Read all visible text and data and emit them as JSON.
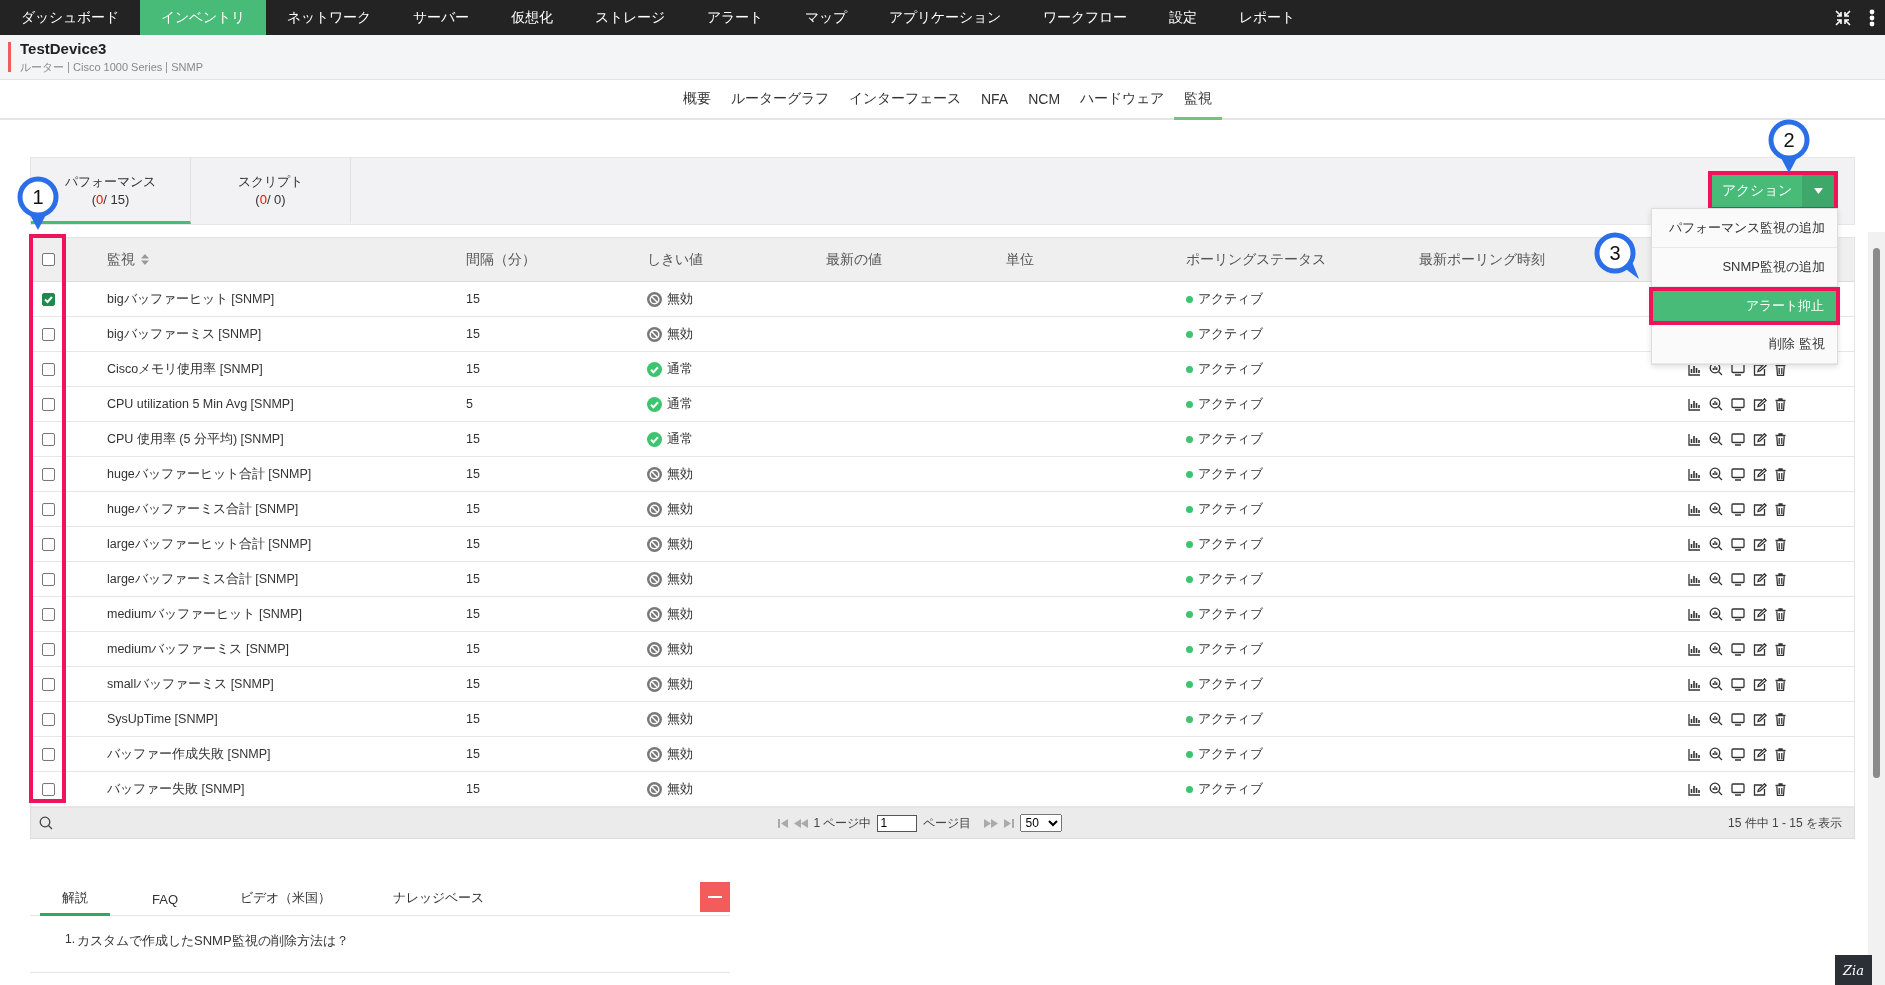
{
  "nav": {
    "items": [
      {
        "label": "ダッシュボード",
        "selected": false
      },
      {
        "label": "インベントリ",
        "selected": true
      },
      {
        "label": "ネットワーク",
        "selected": false
      },
      {
        "label": "サーバー",
        "selected": false
      },
      {
        "label": "仮想化",
        "selected": false
      },
      {
        "label": "ストレージ",
        "selected": false
      },
      {
        "label": "アラート",
        "selected": false
      },
      {
        "label": "マップ",
        "selected": false
      },
      {
        "label": "アプリケーション",
        "selected": false
      },
      {
        "label": "ワークフロー",
        "selected": false
      },
      {
        "label": "設定",
        "selected": false
      },
      {
        "label": "レポート",
        "selected": false
      }
    ]
  },
  "device": {
    "name": "TestDevice3",
    "details": [
      "ルーター",
      "Cisco 1000 Series",
      "SNMP"
    ]
  },
  "subtabs": [
    {
      "label": "概要",
      "selected": false
    },
    {
      "label": "ルーターグラフ",
      "selected": false
    },
    {
      "label": "インターフェース",
      "selected": false
    },
    {
      "label": "NFA",
      "selected": false
    },
    {
      "label": "NCM",
      "selected": false
    },
    {
      "label": "ハードウェア",
      "selected": false
    },
    {
      "label": "監視",
      "selected": true
    }
  ],
  "monitor_tabs": [
    {
      "label": "パフォーマンス",
      "count": {
        "open": "(",
        "value": "0",
        "rest": "/ 15)"
      },
      "selected": true
    },
    {
      "label": "スクリプト",
      "count": {
        "open": "(",
        "value": "0",
        "rest": "/ 0)"
      },
      "selected": false
    }
  ],
  "action_button": {
    "label": "アクション",
    "highlighted": true
  },
  "action_menu": {
    "items": [
      {
        "label": "パフォーマンス監視の追加",
        "selected": false,
        "highlighted": false
      },
      {
        "label": "SNMP監視の追加",
        "selected": false,
        "highlighted": false
      },
      {
        "label": "アラート抑止",
        "selected": true,
        "highlighted": true
      },
      {
        "label": "削除 監視",
        "selected": false,
        "highlighted": false
      }
    ]
  },
  "table": {
    "select_all": {
      "checked": false
    },
    "checkbox_column_highlighted": true,
    "columns": [
      {
        "label": "監視",
        "sortable": true
      },
      {
        "label": "間隔（分）",
        "sortable": false
      },
      {
        "label": "しきい値",
        "sortable": false
      },
      {
        "label": "最新の値",
        "sortable": false
      },
      {
        "label": "単位",
        "sortable": false
      },
      {
        "label": "ポーリングステータス",
        "sortable": false
      },
      {
        "label": "最新ポーリング時刻",
        "sortable": false
      }
    ],
    "rows": [
      {
        "checked": true,
        "name": "bigバッファーヒット [SNMP]",
        "interval": "15",
        "threshold": {
          "kind": "disabled",
          "label": "無効"
        },
        "status": "アクティブ"
      },
      {
        "checked": false,
        "name": "bigバッファーミス [SNMP]",
        "interval": "15",
        "threshold": {
          "kind": "disabled",
          "label": "無効"
        },
        "status": "アクティブ"
      },
      {
        "checked": false,
        "name": "Ciscoメモリ使用率 [SNMP]",
        "interval": "15",
        "threshold": {
          "kind": "normal",
          "label": "通常"
        },
        "status": "アクティブ"
      },
      {
        "checked": false,
        "name": "CPU utilization 5 Min Avg [SNMP]",
        "interval": "5",
        "threshold": {
          "kind": "normal",
          "label": "通常"
        },
        "status": "アクティブ"
      },
      {
        "checked": false,
        "name": "CPU 使用率 (5 分平均) [SNMP]",
        "interval": "15",
        "threshold": {
          "kind": "normal",
          "label": "通常"
        },
        "status": "アクティブ"
      },
      {
        "checked": false,
        "name": "hugeバッファーヒット合計 [SNMP]",
        "interval": "15",
        "threshold": {
          "kind": "disabled",
          "label": "無効"
        },
        "status": "アクティブ"
      },
      {
        "checked": false,
        "name": "hugeバッファーミス合計 [SNMP]",
        "interval": "15",
        "threshold": {
          "kind": "disabled",
          "label": "無効"
        },
        "status": "アクティブ"
      },
      {
        "checked": false,
        "name": "largeバッファーヒット合計 [SNMP]",
        "interval": "15",
        "threshold": {
          "kind": "disabled",
          "label": "無効"
        },
        "status": "アクティブ"
      },
      {
        "checked": false,
        "name": "largeバッファーミス合計 [SNMP]",
        "interval": "15",
        "threshold": {
          "kind": "disabled",
          "label": "無効"
        },
        "status": "アクティブ"
      },
      {
        "checked": false,
        "name": "mediumバッファーヒット [SNMP]",
        "interval": "15",
        "threshold": {
          "kind": "disabled",
          "label": "無効"
        },
        "status": "アクティブ"
      },
      {
        "checked": false,
        "name": "mediumバッファーミス [SNMP]",
        "interval": "15",
        "threshold": {
          "kind": "disabled",
          "label": "無効"
        },
        "status": "アクティブ"
      },
      {
        "checked": false,
        "name": "smallバッファーミス [SNMP]",
        "interval": "15",
        "threshold": {
          "kind": "disabled",
          "label": "無効"
        },
        "status": "アクティブ"
      },
      {
        "checked": false,
        "name": "SysUpTime [SNMP]",
        "interval": "15",
        "threshold": {
          "kind": "disabled",
          "label": "無効"
        },
        "status": "アクティブ"
      },
      {
        "checked": false,
        "name": "バッファー作成失敗 [SNMP]",
        "interval": "15",
        "threshold": {
          "kind": "disabled",
          "label": "無効"
        },
        "status": "アクティブ"
      },
      {
        "checked": false,
        "name": "バッファー失敗 [SNMP]",
        "interval": "15",
        "threshold": {
          "kind": "disabled",
          "label": "無効"
        },
        "status": "アクティブ"
      }
    ]
  },
  "pager": {
    "page_before": "1 ページ中",
    "page": "1",
    "page_after": "ページ目",
    "page_size": "50",
    "summary": "15 件中 1 - 15 を表示"
  },
  "help": {
    "tabs": [
      {
        "label": "解説",
        "selected": true
      },
      {
        "label": "FAQ",
        "selected": false
      },
      {
        "label": "ビデオ（米国）",
        "selected": false
      },
      {
        "label": "ナレッジベース",
        "selected": false
      }
    ],
    "questions": [
      {
        "number": "1.",
        "text": "カスタムで作成したSNMP監視の削除方法は？"
      }
    ]
  },
  "callouts": [
    {
      "label": "1"
    },
    {
      "label": "2"
    },
    {
      "label": "3"
    }
  ],
  "assistant_button": {
    "label": "Zia"
  }
}
